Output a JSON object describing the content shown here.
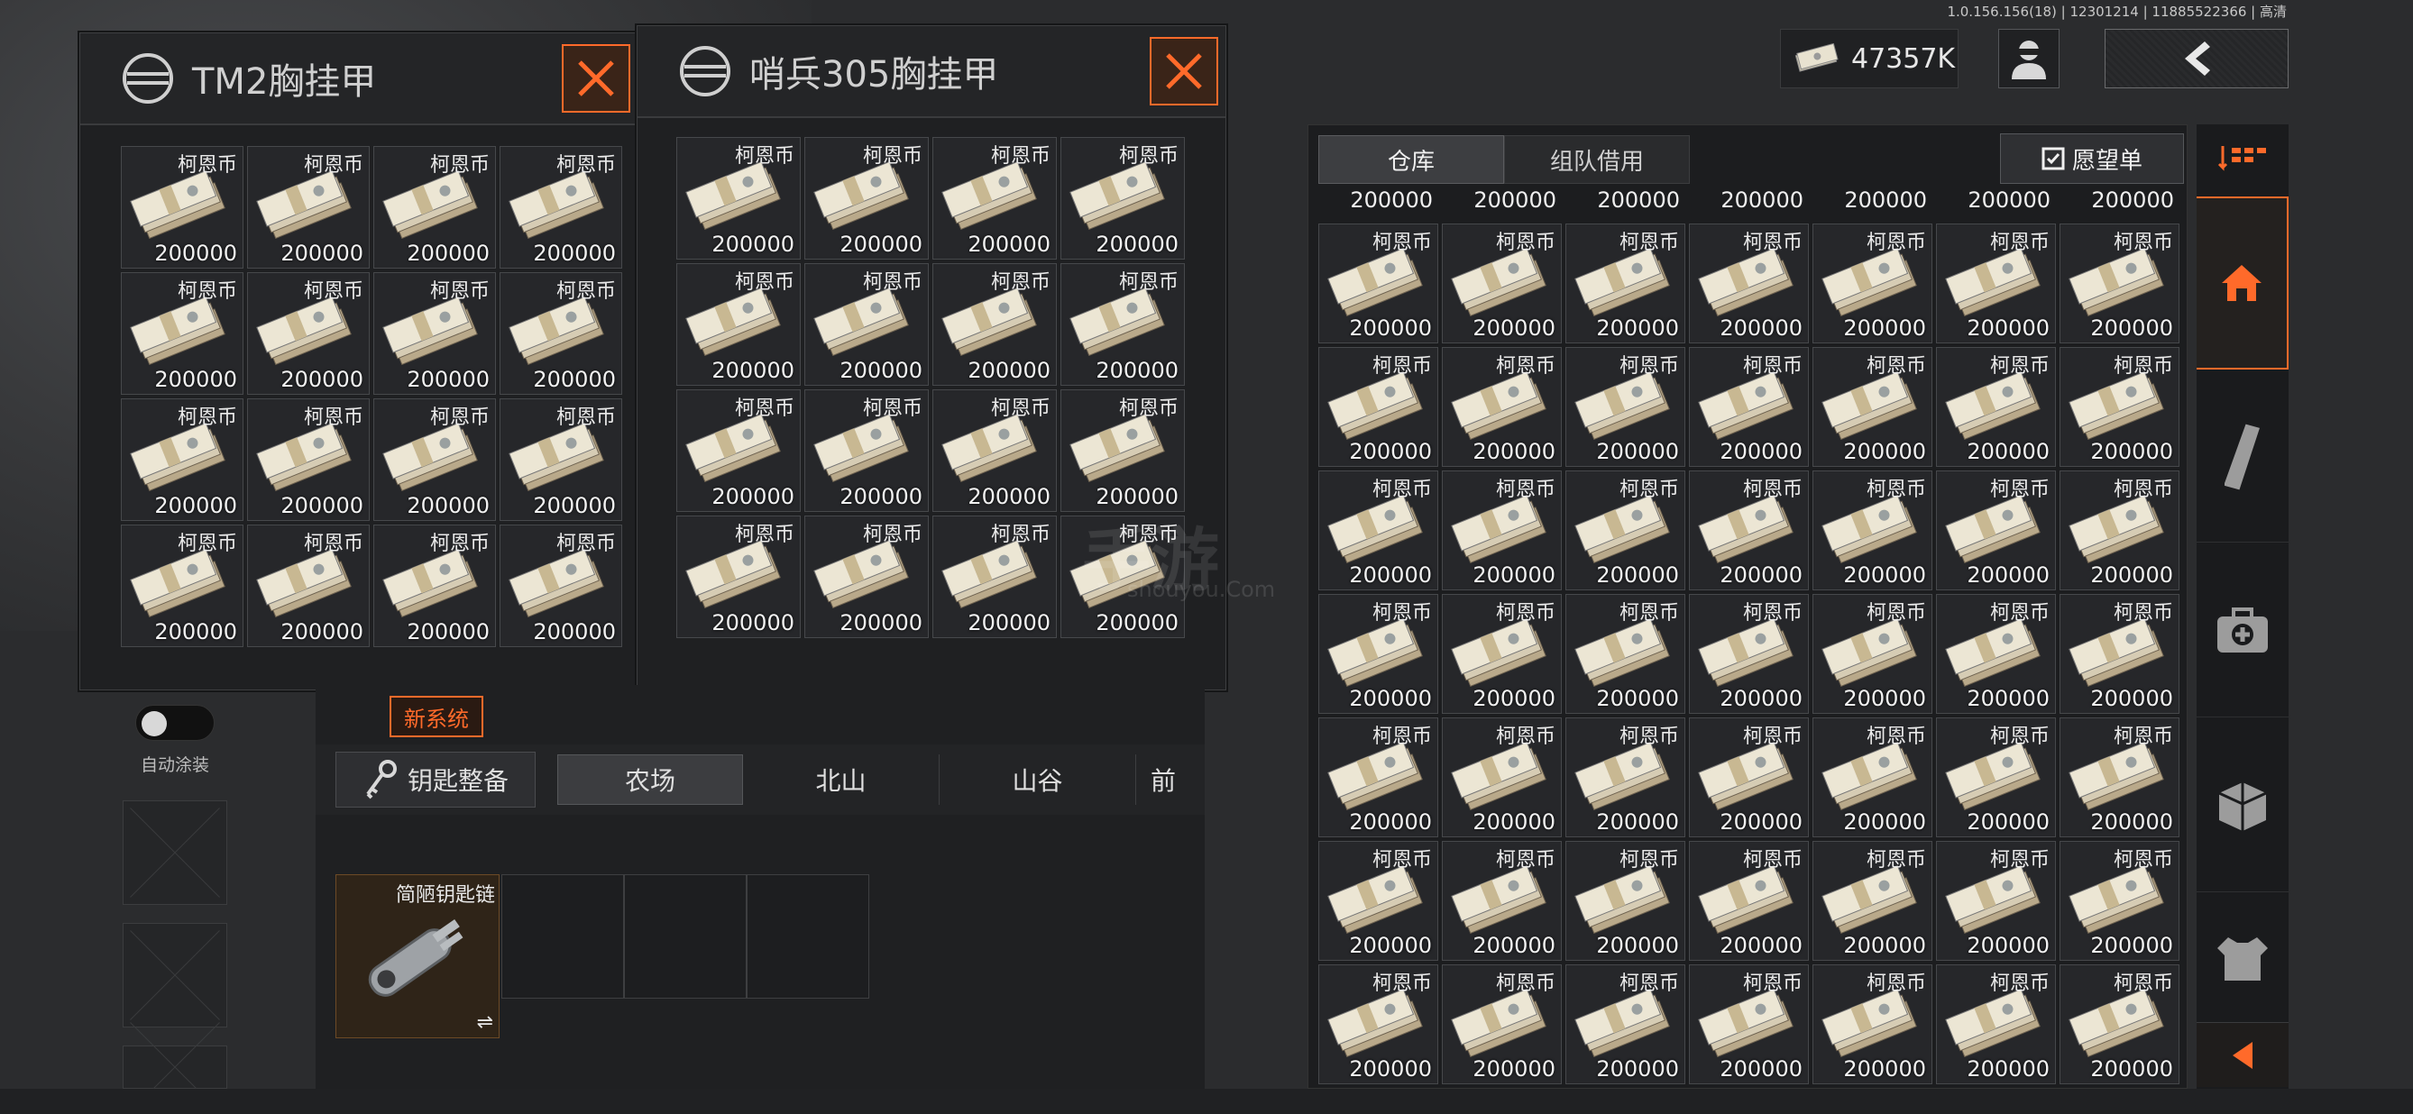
{
  "version": "1.0.156.156(18) | 12301214 | 11885522366 | 高清",
  "currency": {
    "amount": "47357K"
  },
  "rig1": {
    "title": "TM2胸挂甲"
  },
  "rig2": {
    "title": "哨兵305胸挂甲"
  },
  "item": {
    "name": "柯恩币",
    "value": "200000"
  },
  "left_controls": {
    "toggle_label": "自动涂装"
  },
  "new_badge": "新系统",
  "key_button": "钥匙整备",
  "map_tabs": [
    "农场",
    "北山",
    "山谷",
    "前"
  ],
  "keychain": {
    "name": "简陋钥匙链",
    "swap": "⇌"
  },
  "warehouse": {
    "tab_storage": "仓库",
    "tab_team": "组队借用",
    "wishlist": "愿望单",
    "top_values": [
      "200000",
      "200000",
      "200000",
      "200000",
      "200000",
      "200000",
      "200000"
    ]
  },
  "watermark": {
    "main": "手游",
    "sub": "shouyou.Com"
  },
  "colors": {
    "accent": "#ff6a2a",
    "panel": "#1f2022",
    "bill": "#e8e2d0"
  },
  "icons": [
    "money-note-icon",
    "avatar-icon",
    "back-arrow-icon",
    "helmet-icon",
    "close-icon",
    "key-icon",
    "home-icon",
    "magazine-icon",
    "medkit-icon",
    "crate-icon",
    "vest-icon",
    "sort-icon",
    "collapse-arrow-icon",
    "wishlist-icon"
  ]
}
